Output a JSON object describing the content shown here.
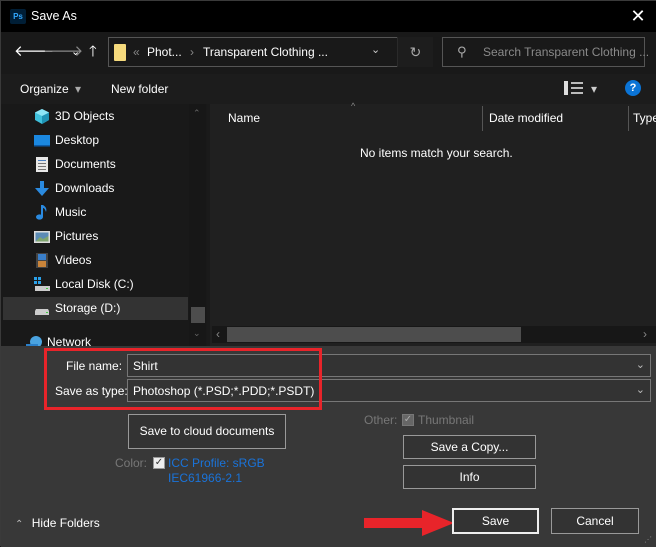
{
  "window": {
    "title": "Save As",
    "app_icon_label": "Ps",
    "close_label": "✕"
  },
  "nav": {
    "back": "🡐",
    "forward": "🡒",
    "recent": "⌄",
    "up": "🡑",
    "address": {
      "overflow": "«",
      "segments": [
        "Phot...",
        "Transparent Clothing ..."
      ],
      "separator": "›",
      "dropdown": "⌄",
      "refresh": "↻"
    },
    "search": {
      "icon": "⚲",
      "placeholder": "Search Transparent Clothing ..."
    }
  },
  "toolbar": {
    "organize": "Organize",
    "organize_caret": "▾",
    "new_folder": "New folder",
    "view_caret": "▾",
    "help": "?"
  },
  "sidebar": {
    "items": [
      {
        "label": "3D Objects",
        "icon": "3d-objects-icon"
      },
      {
        "label": "Desktop",
        "icon": "desktop-icon"
      },
      {
        "label": "Documents",
        "icon": "documents-icon"
      },
      {
        "label": "Downloads",
        "icon": "downloads-icon"
      },
      {
        "label": "Music",
        "icon": "music-icon"
      },
      {
        "label": "Pictures",
        "icon": "pictures-icon"
      },
      {
        "label": "Videos",
        "icon": "videos-icon"
      },
      {
        "label": "Local Disk (C:)",
        "icon": "local-disk-icon"
      },
      {
        "label": "Storage (D:)",
        "icon": "storage-drive-icon",
        "selected": true
      },
      {
        "label": "Network",
        "icon": "network-icon"
      }
    ],
    "scroll_up": "⌃",
    "scroll_down": "⌄"
  },
  "file_list": {
    "columns": [
      "Name",
      "Date modified",
      "Type"
    ],
    "sort_indicator": "^",
    "empty_message": "No items match your search.",
    "scroll_left": "‹",
    "scroll_right": "›"
  },
  "form": {
    "file_name_label": "File name:",
    "file_name_value": "Shirt",
    "save_type_label": "Save as type:",
    "save_type_value": "Photoshop (*.PSD;*.PDD;*.PSDT)",
    "dropdown_chevron": "⌄",
    "cloud_button": "Save to cloud documents",
    "color_label": "Color:",
    "icc_line1": "ICC Profile:  sRGB",
    "icc_line2": "IEC61966-2.1",
    "icc_checked": true,
    "other_label": "Other:",
    "thumbnail_label": "Thumbnail",
    "thumbnail_checked": true,
    "check_mark": "✓",
    "save_copy_button": "Save a Copy...",
    "info_button": "Info"
  },
  "footer": {
    "hide_folders_icon": "⌃",
    "hide_folders": "Hide Folders",
    "save_button": "Save",
    "cancel_button": "Cancel"
  },
  "annotations": {
    "highlight_color": "#e8242a",
    "arrow_color": "#e8242a"
  }
}
